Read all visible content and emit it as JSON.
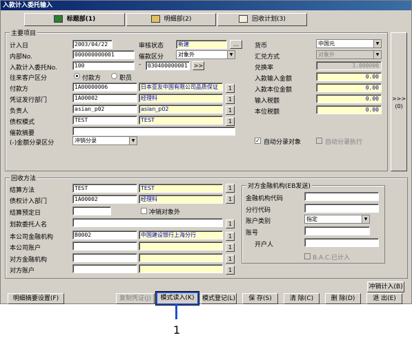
{
  "window": {
    "title": "入款计入委托输入"
  },
  "tabs": [
    {
      "label": "标题部(1)"
    },
    {
      "label": "明细部(2)"
    },
    {
      "label": "回收计划(3)"
    }
  ],
  "main": {
    "legend": "主要项目",
    "booking_date": {
      "label": "计入日",
      "value": "2003/04/22"
    },
    "review_status": {
      "label": "审核状态",
      "value": "新建",
      "button": "..."
    },
    "internal_no": {
      "label": "内部No.",
      "value": "000000000001"
    },
    "debit_class": {
      "label": "催款区分",
      "value": "对象外"
    },
    "delegation_no": {
      "label": "入款计入委托No.",
      "value": "100",
      "dash": "-",
      "value2": "030400000001",
      "jump": ">>"
    },
    "partner_class": {
      "label": "往来客户区分",
      "opt1": "付款方",
      "opt2": "职员"
    },
    "payer": {
      "label": "付款方",
      "code": "1A00000006",
      "name": "日本亚友中国有限公司品质保证"
    },
    "voucher_dept": {
      "label": "凭证发行部门",
      "code": "1A00002",
      "name": "经理科"
    },
    "person": {
      "label": "负责人",
      "code": "asian_p02",
      "name": "asian_p02"
    },
    "pattern": {
      "label": "债权模式",
      "code": "TEST",
      "name": "TEST"
    },
    "summary": {
      "label": "催款摘要",
      "value": ""
    },
    "amount_class": {
      "label": "(-)金额分录区分",
      "value": "冲销分录"
    },
    "currency": {
      "label": "货币",
      "value": "中国元"
    },
    "rate_method": {
      "label": "汇兑方式",
      "value": "对象外"
    },
    "rate": {
      "label": "兑换率",
      "value": "1.000000"
    },
    "input_amount": {
      "label": "入款输入金额",
      "value": "0.00"
    },
    "local_amount": {
      "label": "入款本位金额",
      "value": "0.00"
    },
    "input_tax": {
      "label": "输入税额",
      "value": "0.00"
    },
    "local_tax": {
      "label": "本位税额",
      "value": "0.00"
    },
    "auto_entry": {
      "label": "自动分录对象",
      "checked": true
    },
    "auto_exec": {
      "label": "自动分录执行",
      "checked": false
    },
    "side_button": ">>>\n(0)"
  },
  "collect": {
    "legend": "回收方法",
    "settle_method": {
      "label": "结算方法",
      "code": "TEST",
      "name": "TEST"
    },
    "debt_dept": {
      "label": "债权计入部门",
      "code": "1A00002",
      "name": "经理科"
    },
    "settle_date": {
      "label": "结算预定日",
      "value": ""
    },
    "offset": {
      "label": "冲销对象外"
    },
    "transfer_name": {
      "label": "划款委托人名",
      "value": ""
    },
    "company_bank": {
      "label": "本公司金融机构",
      "code": "B0002",
      "name": "中国建设银行上海分行"
    },
    "company_account": {
      "label": "本公司账户",
      "code": "",
      "name": ""
    },
    "other_bank": {
      "label": "对方金融机构",
      "code": "",
      "name": ""
    },
    "other_account": {
      "label": "对方账户",
      "code": "",
      "name": ""
    }
  },
  "counter": {
    "legend": "对方金融机构(EB发送)",
    "bank_code": {
      "label": "金融机构代码",
      "value": ""
    },
    "branch_code": {
      "label": "分行代码",
      "value": ""
    },
    "account_type": {
      "label": "账户类别",
      "value": "指定"
    },
    "account_no": {
      "label": "账号",
      "value": ""
    },
    "holder": {
      "label": "开户人",
      "value": ""
    },
    "bac": {
      "label": "B.A.C.已计入"
    }
  },
  "buttons": {
    "offset_entry": "冲销计入(B)",
    "detail_summary": "明细摘要设置(F)",
    "copy_voucher": "复制凭证(J)",
    "pattern_input": "模式读入(K)",
    "pattern_register": "模式登记(L)",
    "save": "保 存(S)",
    "clear": "清 除(C)",
    "delete": "删 除(D)",
    "exit": "退 出(E)"
  },
  "callout": {
    "number": "1"
  }
}
